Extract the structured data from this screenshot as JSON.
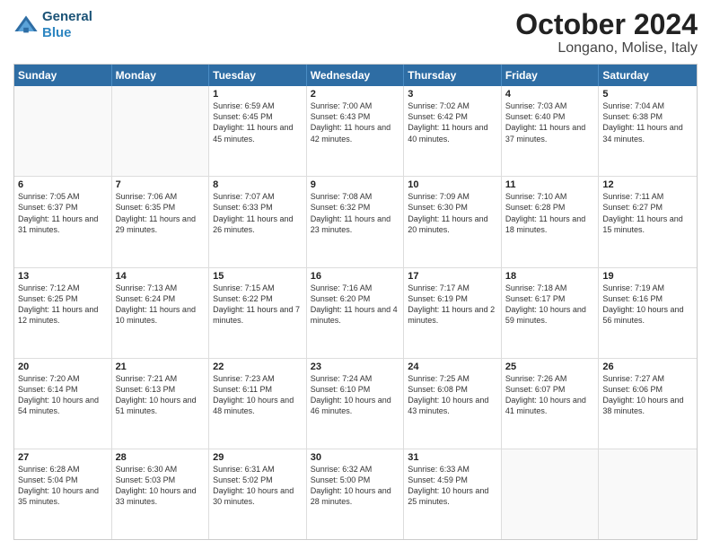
{
  "header": {
    "logo_line1": "General",
    "logo_line2": "Blue",
    "title": "October 2024",
    "subtitle": "Longano, Molise, Italy"
  },
  "weekdays": [
    "Sunday",
    "Monday",
    "Tuesday",
    "Wednesday",
    "Thursday",
    "Friday",
    "Saturday"
  ],
  "rows": [
    [
      {
        "day": "",
        "info": ""
      },
      {
        "day": "",
        "info": ""
      },
      {
        "day": "1",
        "info": "Sunrise: 6:59 AM\nSunset: 6:45 PM\nDaylight: 11 hours and 45 minutes."
      },
      {
        "day": "2",
        "info": "Sunrise: 7:00 AM\nSunset: 6:43 PM\nDaylight: 11 hours and 42 minutes."
      },
      {
        "day": "3",
        "info": "Sunrise: 7:02 AM\nSunset: 6:42 PM\nDaylight: 11 hours and 40 minutes."
      },
      {
        "day": "4",
        "info": "Sunrise: 7:03 AM\nSunset: 6:40 PM\nDaylight: 11 hours and 37 minutes."
      },
      {
        "day": "5",
        "info": "Sunrise: 7:04 AM\nSunset: 6:38 PM\nDaylight: 11 hours and 34 minutes."
      }
    ],
    [
      {
        "day": "6",
        "info": "Sunrise: 7:05 AM\nSunset: 6:37 PM\nDaylight: 11 hours and 31 minutes."
      },
      {
        "day": "7",
        "info": "Sunrise: 7:06 AM\nSunset: 6:35 PM\nDaylight: 11 hours and 29 minutes."
      },
      {
        "day": "8",
        "info": "Sunrise: 7:07 AM\nSunset: 6:33 PM\nDaylight: 11 hours and 26 minutes."
      },
      {
        "day": "9",
        "info": "Sunrise: 7:08 AM\nSunset: 6:32 PM\nDaylight: 11 hours and 23 minutes."
      },
      {
        "day": "10",
        "info": "Sunrise: 7:09 AM\nSunset: 6:30 PM\nDaylight: 11 hours and 20 minutes."
      },
      {
        "day": "11",
        "info": "Sunrise: 7:10 AM\nSunset: 6:28 PM\nDaylight: 11 hours and 18 minutes."
      },
      {
        "day": "12",
        "info": "Sunrise: 7:11 AM\nSunset: 6:27 PM\nDaylight: 11 hours and 15 minutes."
      }
    ],
    [
      {
        "day": "13",
        "info": "Sunrise: 7:12 AM\nSunset: 6:25 PM\nDaylight: 11 hours and 12 minutes."
      },
      {
        "day": "14",
        "info": "Sunrise: 7:13 AM\nSunset: 6:24 PM\nDaylight: 11 hours and 10 minutes."
      },
      {
        "day": "15",
        "info": "Sunrise: 7:15 AM\nSunset: 6:22 PM\nDaylight: 11 hours and 7 minutes."
      },
      {
        "day": "16",
        "info": "Sunrise: 7:16 AM\nSunset: 6:20 PM\nDaylight: 11 hours and 4 minutes."
      },
      {
        "day": "17",
        "info": "Sunrise: 7:17 AM\nSunset: 6:19 PM\nDaylight: 11 hours and 2 minutes."
      },
      {
        "day": "18",
        "info": "Sunrise: 7:18 AM\nSunset: 6:17 PM\nDaylight: 10 hours and 59 minutes."
      },
      {
        "day": "19",
        "info": "Sunrise: 7:19 AM\nSunset: 6:16 PM\nDaylight: 10 hours and 56 minutes."
      }
    ],
    [
      {
        "day": "20",
        "info": "Sunrise: 7:20 AM\nSunset: 6:14 PM\nDaylight: 10 hours and 54 minutes."
      },
      {
        "day": "21",
        "info": "Sunrise: 7:21 AM\nSunset: 6:13 PM\nDaylight: 10 hours and 51 minutes."
      },
      {
        "day": "22",
        "info": "Sunrise: 7:23 AM\nSunset: 6:11 PM\nDaylight: 10 hours and 48 minutes."
      },
      {
        "day": "23",
        "info": "Sunrise: 7:24 AM\nSunset: 6:10 PM\nDaylight: 10 hours and 46 minutes."
      },
      {
        "day": "24",
        "info": "Sunrise: 7:25 AM\nSunset: 6:08 PM\nDaylight: 10 hours and 43 minutes."
      },
      {
        "day": "25",
        "info": "Sunrise: 7:26 AM\nSunset: 6:07 PM\nDaylight: 10 hours and 41 minutes."
      },
      {
        "day": "26",
        "info": "Sunrise: 7:27 AM\nSunset: 6:06 PM\nDaylight: 10 hours and 38 minutes."
      }
    ],
    [
      {
        "day": "27",
        "info": "Sunrise: 6:28 AM\nSunset: 5:04 PM\nDaylight: 10 hours and 35 minutes."
      },
      {
        "day": "28",
        "info": "Sunrise: 6:30 AM\nSunset: 5:03 PM\nDaylight: 10 hours and 33 minutes."
      },
      {
        "day": "29",
        "info": "Sunrise: 6:31 AM\nSunset: 5:02 PM\nDaylight: 10 hours and 30 minutes."
      },
      {
        "day": "30",
        "info": "Sunrise: 6:32 AM\nSunset: 5:00 PM\nDaylight: 10 hours and 28 minutes."
      },
      {
        "day": "31",
        "info": "Sunrise: 6:33 AM\nSunset: 4:59 PM\nDaylight: 10 hours and 25 minutes."
      },
      {
        "day": "",
        "info": ""
      },
      {
        "day": "",
        "info": ""
      }
    ]
  ]
}
